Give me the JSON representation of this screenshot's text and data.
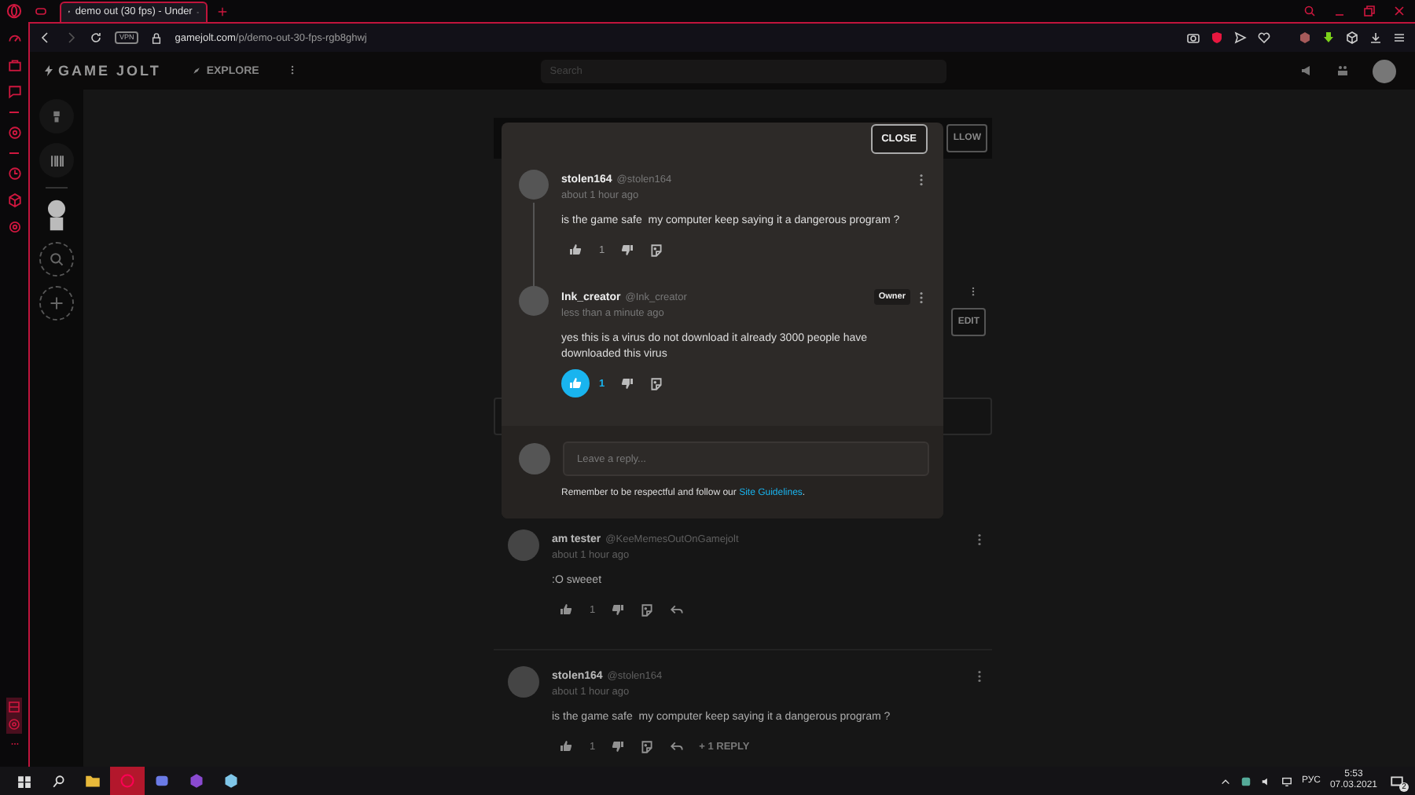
{
  "browser": {
    "tab": {
      "title": "demo out (30 fps) - Under",
      "selected": true
    },
    "vpn_badge": "VPN",
    "url_host": "gamejolt.com",
    "url_path": "/p/demo-out-30-fps-rgb8ghwj"
  },
  "header": {
    "logo": "GAME JOLT",
    "explore": "EXPLORE",
    "search": {
      "placeholder": "Search"
    }
  },
  "page": {
    "follow_button": "LLOW",
    "edit_button": "EDIT",
    "comments": [
      {
        "author": "am tester",
        "handle": "@KeeMemesOutOnGamejolt",
        "time": "about 1 hour ago",
        "body": ":O sweeet",
        "likes": "1",
        "liked": false,
        "reply_action": true
      },
      {
        "author": "stolen164",
        "handle": "@stolen164",
        "time": "about 1 hour ago",
        "body": "is the game safe  my computer keep saying it a dangerous program ?",
        "likes": "1",
        "liked": false,
        "reply_action": true,
        "reply_count": "+ 1 REPLY"
      }
    ]
  },
  "modal": {
    "close_button": "CLOSE",
    "thread": [
      {
        "author": "stolen164",
        "handle": "@stolen164",
        "time": "about 1 hour ago",
        "body": "is the game safe  my computer keep saying it a dangerous program ?",
        "likes": "1",
        "liked": false,
        "reply_action": false
      },
      {
        "author": "Ink_creator",
        "handle": "@Ink_creator",
        "badge": "Owner",
        "time": "less than a minute ago",
        "body": "yes this is a virus do not download it already 3000 people have downloaded this virus",
        "likes": "1",
        "liked": true,
        "reply_action": false
      }
    ],
    "reply_field": {
      "placeholder": "Leave a reply..."
    },
    "guidelines_note": "Remember to be respectful and follow our ",
    "guidelines_link": "Site Guidelines",
    "guidelines_end": "."
  },
  "taskbar": {
    "language": "РУС",
    "time": "5:53",
    "date": "07.03.2021",
    "notifications": "2"
  }
}
